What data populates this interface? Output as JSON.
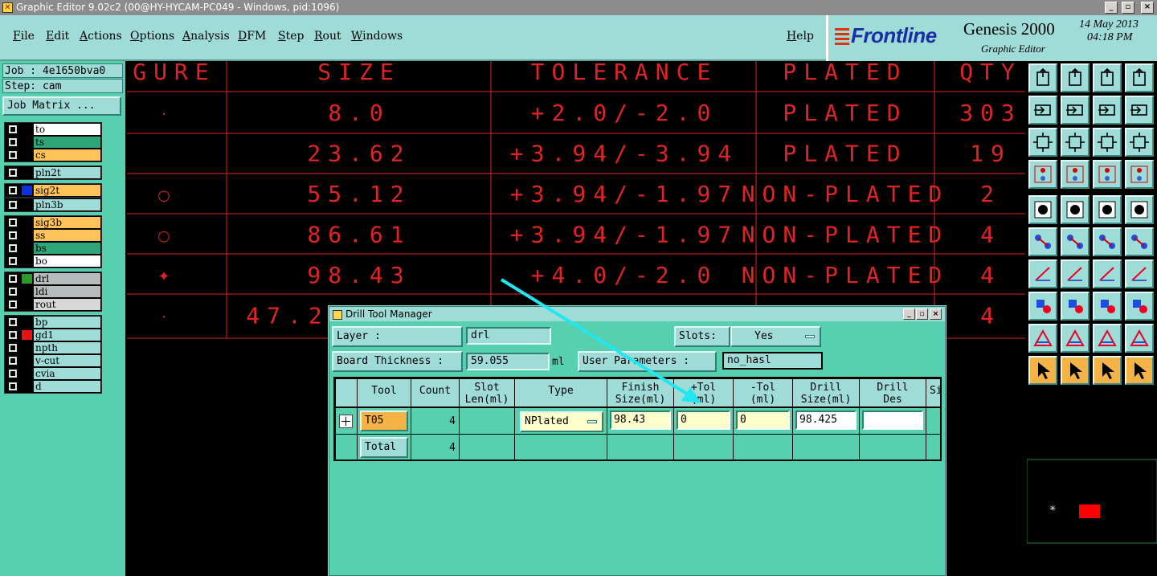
{
  "window": {
    "title": "Graphic Editor 9.02c2 (00@HY-HYCAM-PC049 - Windows, pid:1096)"
  },
  "menu": [
    "File",
    "Edit",
    "Actions",
    "Options",
    "Analysis",
    "DFM",
    "Step",
    "Rout",
    "Windows"
  ],
  "help_label": "Help",
  "logo": {
    "brand": "Frontline",
    "product": "Genesis 2000",
    "subtitle": "Graphic Editor",
    "date": "14 May 2013",
    "time": "04:18 PM"
  },
  "job": {
    "job_label": "Job : 4e1650bva0",
    "step_label": "Step: cam",
    "matrix_button": "Job Matrix ..."
  },
  "layers": [
    {
      "name": "to",
      "color": "#ffffff",
      "swatch": ""
    },
    {
      "name": "ts",
      "color": "#2fa57a",
      "swatch": ""
    },
    {
      "name": "cs",
      "color": "#ffc35a",
      "swatch": ""
    },
    {
      "name": "pln2t",
      "color": "#9fdbd7",
      "swatch": ""
    },
    {
      "name": "sig2t",
      "color": "#ffc35a",
      "swatch": "#1030e0"
    },
    {
      "name": "pln3b",
      "color": "#9fdbd7",
      "swatch": ""
    },
    {
      "name": "sig3b",
      "color": "#ffc35a",
      "swatch": ""
    },
    {
      "name": "ss",
      "color": "#ffc35a",
      "swatch": ""
    },
    {
      "name": "bs",
      "color": "#2fa57a",
      "swatch": ""
    },
    {
      "name": "bo",
      "color": "#ffffff",
      "swatch": ""
    },
    {
      "name": "drl",
      "color": "#b6bcbc",
      "swatch": "#2a9a2a"
    },
    {
      "name": "ldi",
      "color": "#b6bcbc",
      "swatch": ""
    },
    {
      "name": "rout",
      "color": "#d7d7d7",
      "swatch": ""
    },
    {
      "name": "bp",
      "color": "#9fdbd7",
      "swatch": ""
    },
    {
      "name": "gd1",
      "color": "#9fdbd7",
      "swatch": "#ee1111"
    },
    {
      "name": "npth",
      "color": "#9fdbd7",
      "swatch": ""
    },
    {
      "name": "v-cut",
      "color": "#9fdbd7",
      "swatch": ""
    },
    {
      "name": "cvia",
      "color": "#9fdbd7",
      "swatch": ""
    },
    {
      "name": "d",
      "color": "#9fdbd7",
      "swatch": ""
    }
  ],
  "drill_table": {
    "headers": [
      "IGURE",
      "SIZE",
      "TOLERANCE",
      "PLATED",
      "QTY"
    ],
    "rows": [
      {
        "figure": "·",
        "size": "8.0",
        "tolerance": "+2.0/-2.0",
        "plated": "PLATED",
        "qty": "303"
      },
      {
        "figure": "",
        "size": "23.62",
        "tolerance": "+3.94/-3.94",
        "plated": "PLATED",
        "qty": "19"
      },
      {
        "figure": "○",
        "size": "55.12",
        "tolerance": "+3.94/-1.97",
        "plated": "NON-PLATED",
        "qty": "2"
      },
      {
        "figure": "○",
        "size": "86.61",
        "tolerance": "+3.94/-1.97",
        "plated": "NON-PLATED",
        "qty": "4"
      },
      {
        "figure": "✦",
        "size": "98.43",
        "tolerance": "+4.0/-2.0",
        "plated": "NON-PLATED",
        "qty": "4"
      },
      {
        "figure": "·",
        "size": "47.2",
        "tolerance": "",
        "plated": "",
        "qty": "4"
      }
    ]
  },
  "dialog": {
    "title": "Drill Tool Manager",
    "layer_label": "Layer          :",
    "layer_value": "drl",
    "slots_label": "Slots:",
    "slots_value": "Yes",
    "board_thickness_label": "Board Thickness :",
    "board_thickness_value": "59.055",
    "board_thickness_unit": "ml",
    "user_params_label": "User Parameters :",
    "user_params_value": "no_hasl",
    "columns": [
      "Tool",
      "Count",
      "Slot\nLen(ml)",
      "Type",
      "Finish\nSize(ml)",
      "+Tol\n(ml)",
      "-Tol\n(ml)",
      "Drill\nSize(ml)",
      "Drill\nDes",
      "Si"
    ],
    "row": {
      "tool": "T05",
      "count": "4",
      "type": "NPlated",
      "finish_size": "98.43",
      "plus_tol": "0",
      "minus_tol": "0",
      "drill_size": "98.425",
      "drill_des": ""
    },
    "total": {
      "label": "Total",
      "count": "4"
    }
  },
  "colors": {
    "panel": "#9fdbd7",
    "panel_dark": "#57d0b0",
    "drill_text": "#e02424",
    "arrow": "#22e6f0"
  }
}
